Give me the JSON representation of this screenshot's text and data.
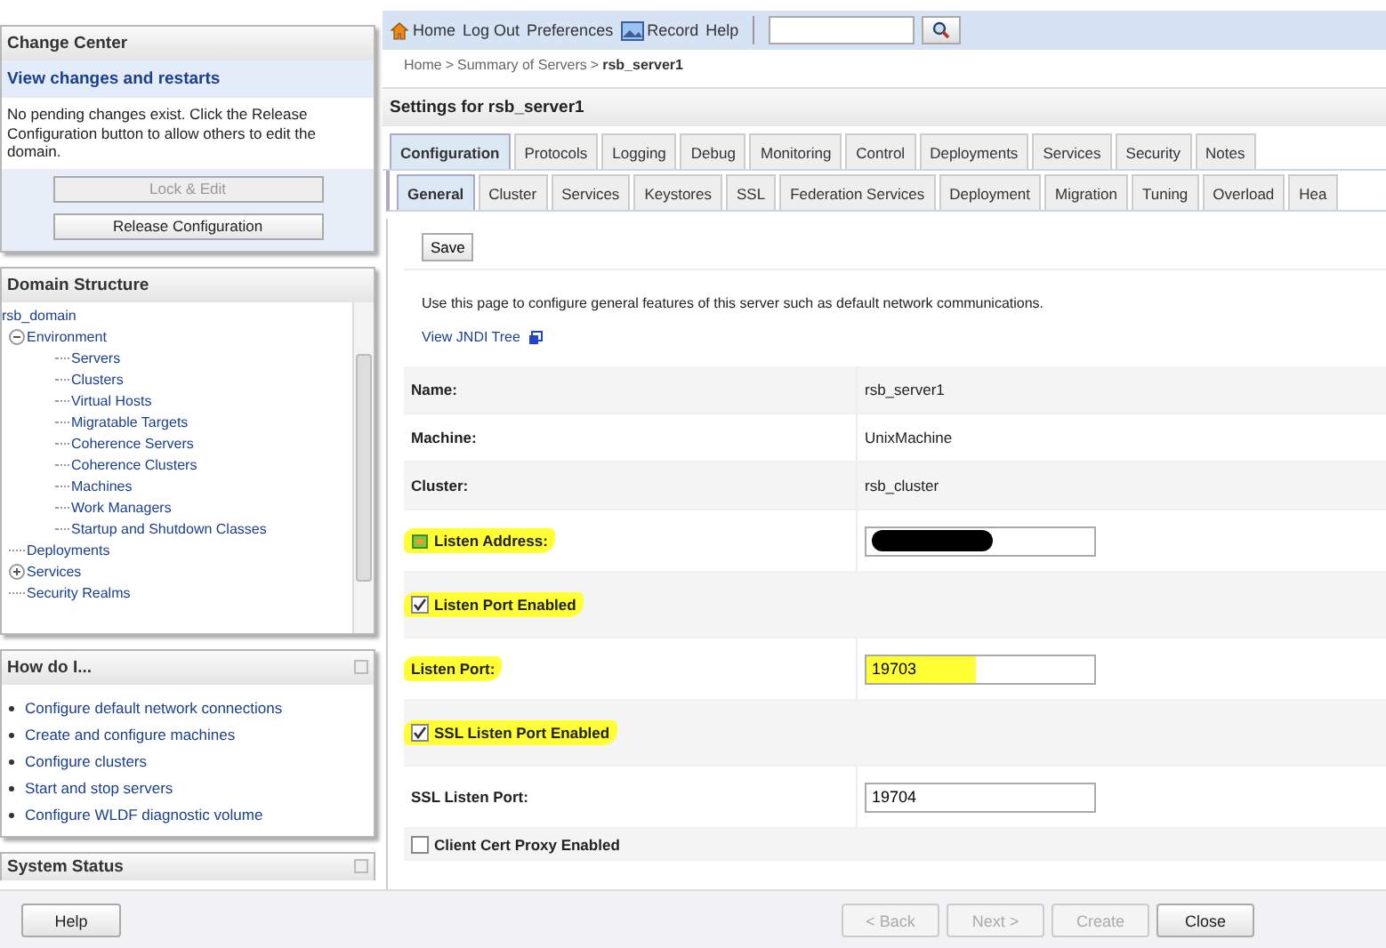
{
  "change_center": {
    "title": "Change Center",
    "link": "View changes and restarts",
    "message": "No pending changes exist. Click the Release Configuration button to allow others to edit the domain.",
    "buttons": [
      {
        "label": "Lock & Edit",
        "disabled": true
      },
      {
        "label": "Release Configuration",
        "disabled": false
      }
    ]
  },
  "domain_structure": {
    "title": "Domain Structure",
    "tree": [
      {
        "label": "rsb_domain",
        "children": [
          {
            "label": "Environment",
            "expanded": true,
            "children": [
              {
                "label": "Servers"
              },
              {
                "label": "Clusters"
              },
              {
                "label": "Virtual Hosts"
              },
              {
                "label": "Migratable Targets"
              },
              {
                "label": "Coherence Servers"
              },
              {
                "label": "Coherence Clusters"
              },
              {
                "label": "Machines"
              },
              {
                "label": "Work Managers"
              },
              {
                "label": "Startup and Shutdown Classes"
              }
            ]
          },
          {
            "label": "Deployments"
          },
          {
            "label": "Services",
            "expanded": false
          },
          {
            "label": "Security Realms"
          }
        ]
      }
    ]
  },
  "how_do_i": {
    "title": "How do I...",
    "links": [
      "Configure default network connections",
      "Create and configure machines",
      "Configure clusters",
      "Start and stop servers",
      "Configure WLDF diagnostic volume"
    ]
  },
  "system_status": {
    "title": "System Status"
  },
  "toolbar": {
    "links": [
      {
        "label": "Home"
      },
      {
        "label": "Log Out"
      },
      {
        "label": "Preferences"
      },
      {
        "label": "Record"
      },
      {
        "label": "Help"
      }
    ]
  },
  "breadcrumb": [
    {
      "label": "Home",
      "current": false
    },
    {
      "label": "Summary of Servers",
      "current": false
    },
    {
      "label": "rsb_server1",
      "current": true
    }
  ],
  "breadcrumb_separator": ">",
  "settings": {
    "title": "Settings for rsb_server1",
    "tabs": [
      {
        "label": "Configuration",
        "selected": true
      },
      {
        "label": "Protocols",
        "selected": false
      },
      {
        "label": "Logging",
        "selected": false
      },
      {
        "label": "Debug",
        "selected": false
      },
      {
        "label": "Monitoring",
        "selected": false
      },
      {
        "label": "Control",
        "selected": false
      },
      {
        "label": "Deployments",
        "selected": false
      },
      {
        "label": "Services",
        "selected": false
      },
      {
        "label": "Security",
        "selected": false
      },
      {
        "label": "Notes",
        "selected": false
      }
    ],
    "subtabs": [
      {
        "label": "General",
        "selected": true
      },
      {
        "label": "Cluster",
        "selected": false
      },
      {
        "label": "Services",
        "selected": false
      },
      {
        "label": "Keystores",
        "selected": false
      },
      {
        "label": "SSL",
        "selected": false
      },
      {
        "label": "Federation Services",
        "selected": false
      },
      {
        "label": "Deployment",
        "selected": false
      },
      {
        "label": "Migration",
        "selected": false
      },
      {
        "label": "Tuning",
        "selected": false
      },
      {
        "label": "Overload",
        "selected": false
      },
      {
        "label": "Hea",
        "selected": false
      }
    ],
    "save_button": "Save",
    "intro": "Use this page to configure general features of this server such as default network communications.",
    "jndi_link": "View JNDI Tree",
    "fields": [
      {
        "kind": "text",
        "label": "Name:",
        "value": "rsb_server1",
        "highlighted": false
      },
      {
        "kind": "text",
        "label": "Machine:",
        "value": "UnixMachine",
        "highlighted": false
      },
      {
        "kind": "text",
        "label": "Cluster:",
        "value": "rsb_cluster",
        "highlighted": false
      },
      {
        "kind": "input",
        "label": "Listen Address:",
        "redacted": true,
        "highlighted": true
      },
      {
        "kind": "checkbox",
        "label": "Listen Port Enabled",
        "checked": true,
        "highlighted": true
      },
      {
        "kind": "input",
        "label": "Listen Port:",
        "value": "19703",
        "highlighted": true
      },
      {
        "kind": "checkbox",
        "label": "SSL Listen Port Enabled",
        "checked": true,
        "highlighted": true
      },
      {
        "kind": "input",
        "label": "SSL Listen Port:",
        "value": "19704",
        "highlighted": false
      },
      {
        "kind": "checkbox",
        "label": "Client Cert Proxy Enabled",
        "checked": false,
        "highlighted": false
      }
    ]
  },
  "footer": {
    "help_button": {
      "label": "Help",
      "disabled": false
    },
    "buttons": [
      {
        "label": "< Back",
        "disabled": true
      },
      {
        "label": "Next >",
        "disabled": true
      },
      {
        "label": "Create",
        "disabled": true
      },
      {
        "label": "Close",
        "disabled": false
      }
    ]
  }
}
